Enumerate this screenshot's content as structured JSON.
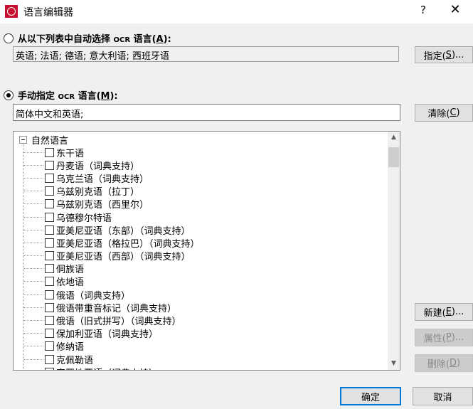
{
  "window": {
    "title": "语言编辑器",
    "help_glyph": "?",
    "close_glyph": "✕"
  },
  "auto_select": {
    "label_prefix": "从以下列表中自动选择 ",
    "label_ocr": "OCR",
    "label_mid": " 语言(",
    "label_key": "A",
    "label_suffix": "):",
    "selected": false,
    "languages_value": "英语; 法语; 德语; 意大利语; 西班牙语"
  },
  "manual_select": {
    "label_prefix": "手动指定 ",
    "label_ocr": "OCR",
    "label_mid": " 语言(",
    "label_key": "M",
    "label_suffix": "):",
    "selected": true,
    "languages_value": "简体中文和英语;"
  },
  "buttons": {
    "specify": {
      "text": "指定(",
      "key": "S",
      "suffix": ")..."
    },
    "clear": {
      "text": "清除(",
      "key": "C",
      "suffix": ")"
    },
    "new": {
      "text": "新建(",
      "key": "E",
      "suffix": ")..."
    },
    "properties": {
      "text": "属性(",
      "key": "P",
      "suffix": ")..."
    },
    "delete": {
      "text": "删除(",
      "key": "D",
      "suffix": ")"
    },
    "ok": "确定",
    "cancel": "取消"
  },
  "tree": {
    "root_label": "自然语言",
    "items": [
      "东干语",
      "丹麦语（词典支持）",
      "乌克兰语（词典支持）",
      "乌兹别克语（拉丁）",
      "乌兹别克语（西里尔）",
      "乌德穆尔特语",
      "亚美尼亚语（东部）（词典支持）",
      "亚美尼亚语（格拉巴）（词典支持）",
      "亚美尼亚语（西部）（词典支持）",
      "侗族语",
      "依地语",
      "俄语（词典支持）",
      "俄语带重音标记（词典支持）",
      "俄语（旧式拼写）（词典支持）",
      "保加利亚语（词典支持）",
      "修纳语",
      "克佩勒语",
      "克罗地亚语（词典支持）"
    ]
  },
  "icons": {
    "scroll_up": "▲",
    "scroll_down": "▼"
  },
  "colors": {
    "app_icon": "#c8102e",
    "default_button_border": "#0078d7"
  }
}
